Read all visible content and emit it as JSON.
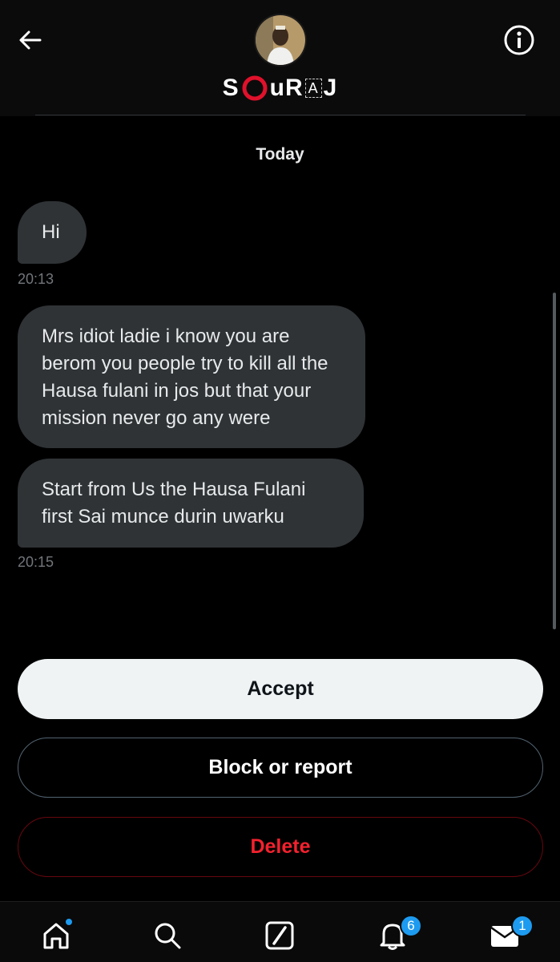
{
  "header": {
    "display_name_parts": [
      "S",
      "uR",
      "A",
      "J"
    ],
    "back_icon": "arrow-left-icon",
    "info_icon": "info-circle-icon",
    "avatar_icon": "avatar"
  },
  "conversation": {
    "date_label": "Today",
    "messages": [
      {
        "text": "Hi",
        "time": "20:13"
      },
      {
        "text": "Mrs idiot ladie i know you are berom you people try to kill all the Hausa fulani in jos but that your mission never go any were"
      },
      {
        "text": "Start from Us the Hausa Fulani first Sai munce durin uwarku",
        "time": "20:15"
      }
    ]
  },
  "actions": {
    "accept_label": "Accept",
    "block_label": "Block or report",
    "delete_label": "Delete"
  },
  "bottom_nav": {
    "items": [
      "home-icon",
      "search-icon",
      "grok-icon",
      "bell-icon",
      "envelope-icon"
    ],
    "notifications_badge": "6",
    "messages_badge": "1"
  },
  "colors": {
    "accent": "#1d9bf0",
    "danger": "#f4212e",
    "bubble": "#2f3336",
    "background": "#000000"
  }
}
